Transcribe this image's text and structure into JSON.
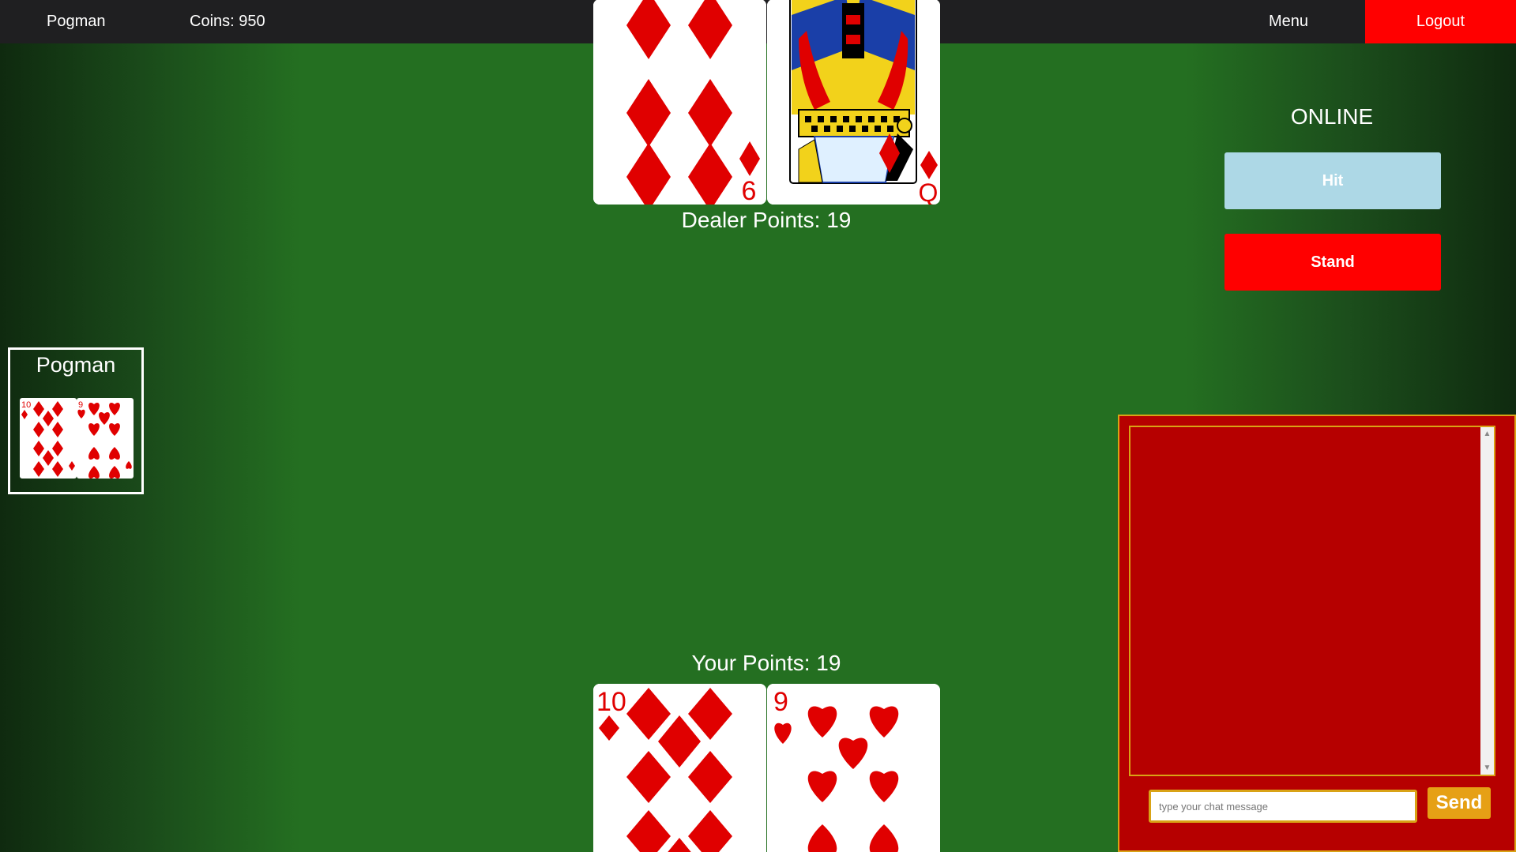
{
  "nav": {
    "username": "Pogman",
    "coins": "Coins: 950",
    "menu": "Menu",
    "logout": "Logout"
  },
  "colors": {
    "felt": "#246f21",
    "navbar": "#1f1f21",
    "logout": "#ff0000",
    "hit": "#add8e6",
    "stand": "#ff0000",
    "chat_bg": "#b60000",
    "chat_border": "#d9a316",
    "send": "#e6a015",
    "suit_red": "#e00000"
  },
  "dealer": {
    "points_label": "Dealer Points: 19",
    "cards": [
      {
        "rank": "6",
        "suit": "diamonds"
      },
      {
        "rank": "Q",
        "suit": "diamonds"
      }
    ]
  },
  "player": {
    "points_label": "Your Points: 19",
    "cards": [
      {
        "rank": "10",
        "suit": "diamonds"
      },
      {
        "rank": "9",
        "suit": "hearts"
      }
    ]
  },
  "seat": {
    "name": "Pogman",
    "cards": [
      {
        "rank": "10",
        "suit": "diamonds"
      },
      {
        "rank": "9",
        "suit": "hearts"
      }
    ]
  },
  "status": "ONLINE",
  "actions": {
    "hit": "Hit",
    "stand": "Stand"
  },
  "chat": {
    "placeholder": "type your chat message",
    "send": "Send"
  }
}
